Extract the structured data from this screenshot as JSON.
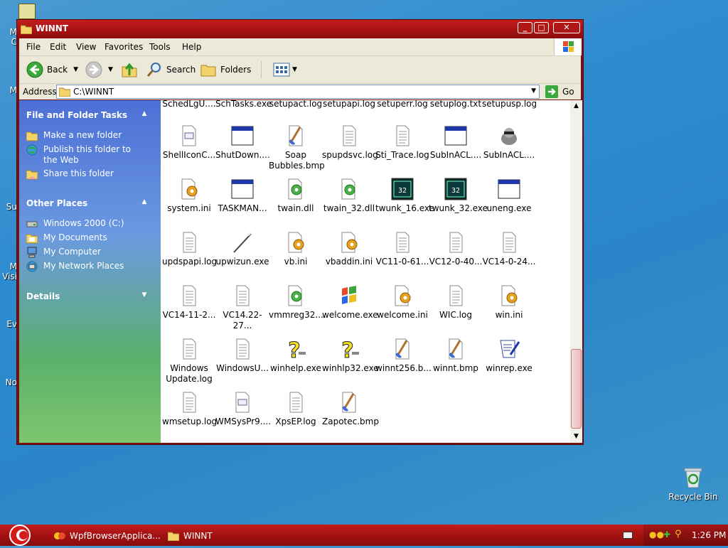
{
  "desktop": {
    "edge_labels": [
      "M",
      "C",
      "M",
      "Su",
      "M",
      "Visi",
      "Ev",
      "No"
    ],
    "recycle_bin_label": "Recycle Bin"
  },
  "window": {
    "title": "WINNT",
    "controls": {
      "minimize": "_",
      "maximize": "□",
      "close": "✕"
    }
  },
  "menu": [
    "File",
    "Edit",
    "View",
    "Favorites",
    "Tools",
    "Help"
  ],
  "toolbar": {
    "back_label": "Back",
    "search_label": "Search",
    "folders_label": "Folders"
  },
  "address": {
    "label": "Address",
    "value": "C:\\WINNT",
    "go_label": "Go"
  },
  "left_panel": {
    "file_folder_tasks": {
      "title": "File and Folder Tasks",
      "items": [
        "Make a new folder",
        "Publish this folder to the Web",
        "Share this folder"
      ]
    },
    "other_places": {
      "title": "Other Places",
      "items": [
        "Windows 2000 (C:)",
        "My Documents",
        "My Computer",
        "My Network Places"
      ]
    },
    "details": {
      "title": "Details"
    }
  },
  "files": [
    {
      "name": "SchedLgU....",
      "icon": "log"
    },
    {
      "name": "SchTasks.exe",
      "icon": "exe"
    },
    {
      "name": "setupact.log",
      "icon": "log"
    },
    {
      "name": "setupapi.log",
      "icon": "log"
    },
    {
      "name": "setuperr.log",
      "icon": "log"
    },
    {
      "name": "setuplog.txt",
      "icon": "log"
    },
    {
      "name": "setupusp.log",
      "icon": "log"
    },
    {
      "name": "ShellIconC...",
      "icon": "data"
    },
    {
      "name": "ShutDown....",
      "icon": "exe"
    },
    {
      "name": "Soap Bubbles.bmp",
      "icon": "bmp"
    },
    {
      "name": "spupdsvc.log",
      "icon": "log"
    },
    {
      "name": "Sti_Trace.log",
      "icon": "log"
    },
    {
      "name": "SubInACL....",
      "icon": "exe"
    },
    {
      "name": "SubInACL....",
      "icon": "raccoon"
    },
    {
      "name": "system.ini",
      "icon": "ini"
    },
    {
      "name": "TASKMAN...",
      "icon": "exe"
    },
    {
      "name": "twain.dll",
      "icon": "dll"
    },
    {
      "name": "twain_32.dll",
      "icon": "dll"
    },
    {
      "name": "twunk_16.exe",
      "icon": "twunk"
    },
    {
      "name": "twunk_32.exe",
      "icon": "twunk"
    },
    {
      "name": "uneng.exe",
      "icon": "exe"
    },
    {
      "name": "updspapi.log",
      "icon": "log"
    },
    {
      "name": "upwizun.exe",
      "icon": "wand"
    },
    {
      "name": "vb.ini",
      "icon": "ini"
    },
    {
      "name": "vbaddin.ini",
      "icon": "ini"
    },
    {
      "name": "VC11-0-61...",
      "icon": "log"
    },
    {
      "name": "VC12-0-40...",
      "icon": "log"
    },
    {
      "name": "VC14-0-24...",
      "icon": "log"
    },
    {
      "name": "VC14-11-2...",
      "icon": "log"
    },
    {
      "name": "VC14.22-27...",
      "icon": "log"
    },
    {
      "name": "vmmreg32....",
      "icon": "dll"
    },
    {
      "name": "welcome.exe",
      "icon": "winflag"
    },
    {
      "name": "welcome.ini",
      "icon": "ini"
    },
    {
      "name": "WIC.log",
      "icon": "log"
    },
    {
      "name": "win.ini",
      "icon": "ini"
    },
    {
      "name": "Windows Update.log",
      "icon": "log"
    },
    {
      "name": "WindowsU...",
      "icon": "log"
    },
    {
      "name": "winhelp.exe",
      "icon": "help"
    },
    {
      "name": "winhlp32.exe",
      "icon": "help"
    },
    {
      "name": "winnt256.b...",
      "icon": "bmp"
    },
    {
      "name": "winnt.bmp",
      "icon": "bmp"
    },
    {
      "name": "winrep.exe",
      "icon": "scroll"
    },
    {
      "name": "wmsetup.log",
      "icon": "log"
    },
    {
      "name": "WMSysPr9....",
      "icon": "data"
    },
    {
      "name": "XpsEP.log",
      "icon": "log"
    },
    {
      "name": "Zapotec.bmp",
      "icon": "bmp"
    }
  ],
  "taskbar": {
    "buttons": [
      "WpfBrowserApplica...",
      "WINNT"
    ],
    "clock": "1:26 PM"
  },
  "colors": {
    "titlebar": "#b01818",
    "taskbar": "#a31212",
    "left_panel_top": "#4c6fd6",
    "left_panel_bottom": "#7cc66d"
  }
}
